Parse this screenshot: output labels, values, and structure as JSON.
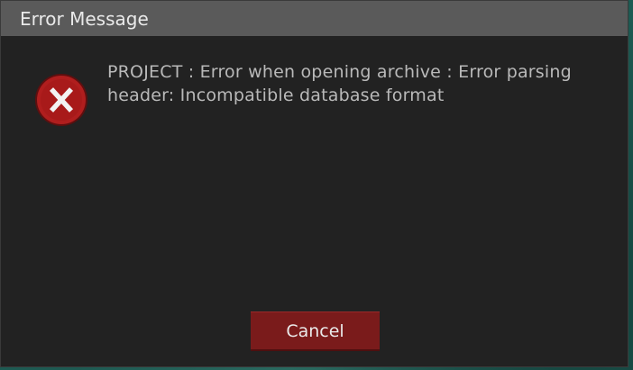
{
  "dialog": {
    "title": "Error Message",
    "icon": "error-x-icon",
    "message": "PROJECT : Error when opening archive : Error parsing header: Incompatible database format",
    "cancel_label": "Cancel"
  },
  "colors": {
    "titlebar": "#5a5a5a",
    "body": "#222222",
    "icon_red": "#b01e1e",
    "button_red": "#7a1b1b"
  }
}
